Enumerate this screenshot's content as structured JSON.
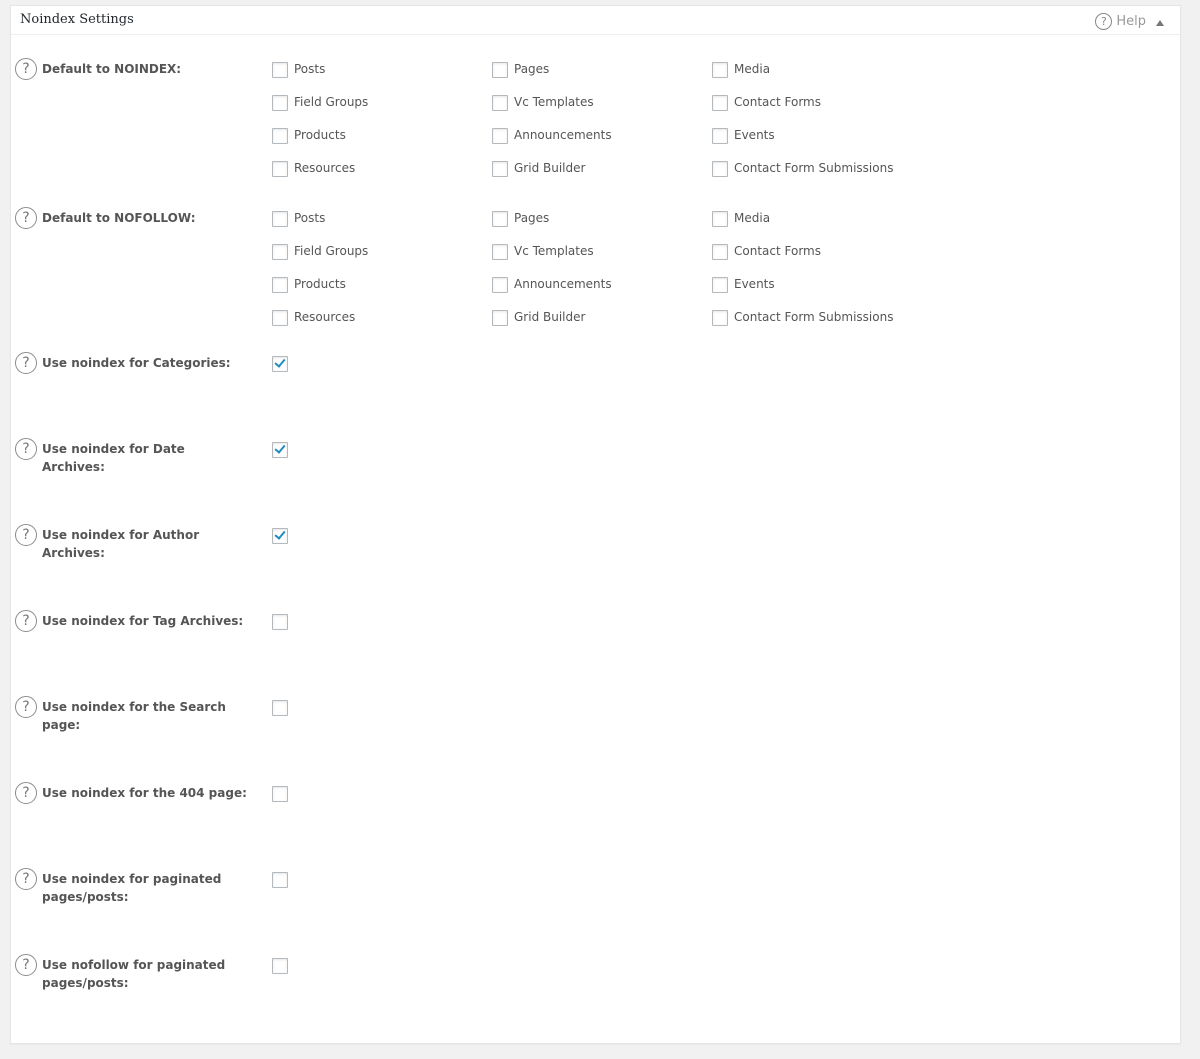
{
  "panel": {
    "title": "Noindex Settings",
    "help_label": "Help",
    "help_icon": "?",
    "collapse_icon": "triangle-up-icon"
  },
  "question_icon": "?",
  "groups": [
    {
      "label": "Default to NOINDEX:",
      "options": [
        [
          {
            "label": "Posts",
            "checked": false
          },
          {
            "label": "Pages",
            "checked": false
          },
          {
            "label": "Media",
            "checked": false
          }
        ],
        [
          {
            "label": "Field Groups",
            "checked": false
          },
          {
            "label": "Vc Templates",
            "checked": false
          },
          {
            "label": "Contact Forms",
            "checked": false
          }
        ],
        [
          {
            "label": "Products",
            "checked": false
          },
          {
            "label": "Announcements",
            "checked": false
          },
          {
            "label": "Events",
            "checked": false
          }
        ],
        [
          {
            "label": "Resources",
            "checked": false
          },
          {
            "label": "Grid Builder",
            "checked": false
          },
          {
            "label": "Contact Form Submissions",
            "checked": false
          }
        ]
      ]
    },
    {
      "label": "Default to NOFOLLOW:",
      "options": [
        [
          {
            "label": "Posts",
            "checked": false
          },
          {
            "label": "Pages",
            "checked": false
          },
          {
            "label": "Media",
            "checked": false
          }
        ],
        [
          {
            "label": "Field Groups",
            "checked": false
          },
          {
            "label": "Vc Templates",
            "checked": false
          },
          {
            "label": "Contact Forms",
            "checked": false
          }
        ],
        [
          {
            "label": "Products",
            "checked": false
          },
          {
            "label": "Announcements",
            "checked": false
          },
          {
            "label": "Events",
            "checked": false
          }
        ],
        [
          {
            "label": "Resources",
            "checked": false
          },
          {
            "label": "Grid Builder",
            "checked": false
          },
          {
            "label": "Contact Form Submissions",
            "checked": false
          }
        ]
      ]
    }
  ],
  "single_settings": [
    {
      "label": "Use noindex for Categories:",
      "checked": true
    },
    {
      "label": "Use noindex for Date Archives:",
      "checked": true
    },
    {
      "label": "Use noindex for Author Archives:",
      "checked": true
    },
    {
      "label": "Use noindex for Tag Archives:",
      "checked": false
    },
    {
      "label": "Use noindex for the Search page:",
      "checked": false
    },
    {
      "label": "Use noindex for the 404 page:",
      "checked": false
    },
    {
      "label": "Use noindex for paginated pages/posts:",
      "checked": false
    },
    {
      "label": "Use nofollow for paginated pages/posts:",
      "checked": false
    }
  ],
  "colors": {
    "background": "#f1f1f1",
    "panel": "#ffffff",
    "check_accent": "#1e8cbe",
    "label_text": "#555555"
  }
}
